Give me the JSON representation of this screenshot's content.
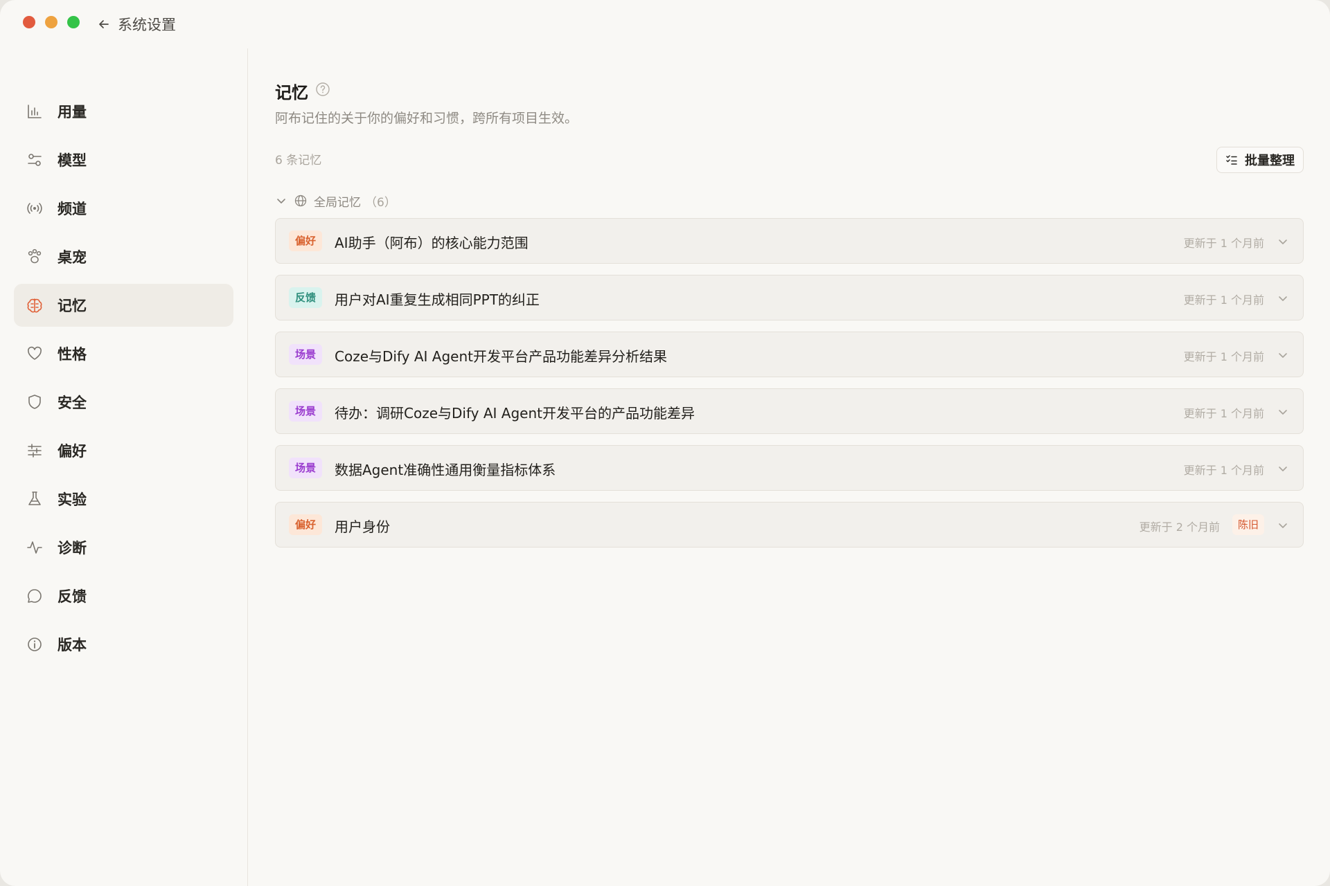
{
  "window": {
    "back_title": "系统设置"
  },
  "sidebar": {
    "items": [
      {
        "label": "用量",
        "icon": "bar-chart-icon",
        "active": false
      },
      {
        "label": "模型",
        "icon": "sliders-toggle-icon",
        "active": false
      },
      {
        "label": "频道",
        "icon": "broadcast-icon",
        "active": false
      },
      {
        "label": "桌宠",
        "icon": "paw-icon",
        "active": false
      },
      {
        "label": "记忆",
        "icon": "brain-icon",
        "active": true
      },
      {
        "label": "性格",
        "icon": "heart-icon",
        "active": false
      },
      {
        "label": "安全",
        "icon": "shield-icon",
        "active": false
      },
      {
        "label": "偏好",
        "icon": "sliders-icon",
        "active": false
      },
      {
        "label": "实验",
        "icon": "flask-icon",
        "active": false
      },
      {
        "label": "诊断",
        "icon": "activity-icon",
        "active": false
      },
      {
        "label": "反馈",
        "icon": "chat-bubble-icon",
        "active": false
      },
      {
        "label": "版本",
        "icon": "info-icon",
        "active": false
      }
    ]
  },
  "main": {
    "title": "记忆",
    "description": "阿布记住的关于你的偏好和习惯，跨所有项目生效。",
    "count_label": "6 条记忆",
    "batch_button": "批量整理",
    "group": {
      "label": "全局记忆",
      "count": "（6）"
    },
    "memories": [
      {
        "tag": "偏好",
        "tag_type": "preference",
        "title": "AI助手（阿布）的核心能力范围",
        "updated": "更新于 1 个月前"
      },
      {
        "tag": "反馈",
        "tag_type": "feedback",
        "title": "用户对AI重复生成相同PPT的纠正",
        "updated": "更新于 1 个月前"
      },
      {
        "tag": "场景",
        "tag_type": "scenario",
        "title": "Coze与Dify AI Agent开发平台产品功能差异分析结果",
        "updated": "更新于 1 个月前"
      },
      {
        "tag": "场景",
        "tag_type": "scenario",
        "title": "待办：调研Coze与Dify AI Agent开发平台的产品功能差异",
        "updated": "更新于 1 个月前"
      },
      {
        "tag": "场景",
        "tag_type": "scenario",
        "title": "数据Agent准确性通用衡量指标体系",
        "updated": "更新于 1 个月前"
      },
      {
        "tag": "偏好",
        "tag_type": "preference",
        "title": "用户身份",
        "updated": "更新于 2 个月前",
        "stale_label": "陈旧"
      }
    ]
  },
  "colors": {
    "accent": "#e0623a",
    "preference_bg": "#fde7d8",
    "preference_fg": "#d9622f",
    "feedback_bg": "#d9f3ee",
    "feedback_fg": "#2f8f7d",
    "scenario_bg": "#f1e2fb",
    "scenario_fg": "#9a3ccf"
  }
}
